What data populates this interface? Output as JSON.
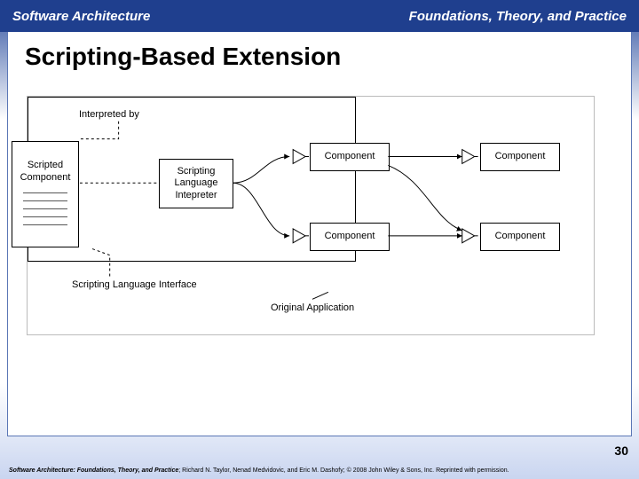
{
  "header": {
    "left": "Software Architecture",
    "right": "Foundations, Theory, and Practice"
  },
  "title": "Scripting-Based Extension",
  "diagram": {
    "labels": {
      "interpreted_by": "Interpreted by",
      "scripting_lang_interface": "Scripting Language Interface",
      "original_application": "Original Application"
    },
    "boxes": {
      "scripted_component": "Scripted Component",
      "interpreter": "Scripting Language Intepreter",
      "comp1": "Component",
      "comp2": "Component",
      "comp3": "Component",
      "comp4": "Component"
    }
  },
  "page_number": "30",
  "footer": {
    "title": "Software Architecture: Foundations, Theory, and Practice",
    "rest": "; Richard N. Taylor, Nenad Medvidovic, and Eric M. Dashofy; © 2008 John Wiley & Sons, Inc. Reprinted with permission."
  }
}
